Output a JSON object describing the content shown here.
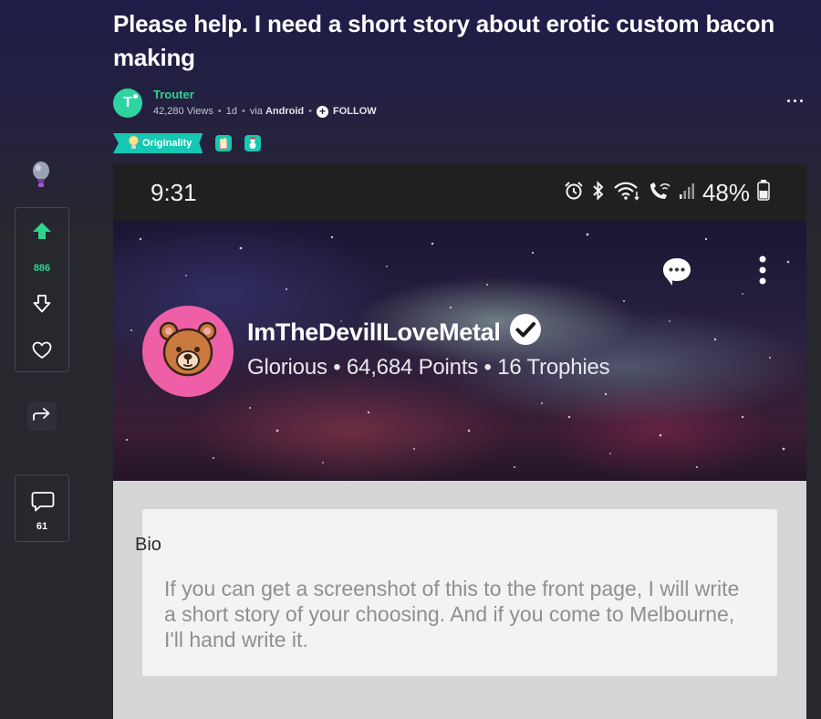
{
  "post": {
    "title": "Please help. I need a short story about erotic custom bacon making",
    "author": "Trouter",
    "avatar_letter": "T",
    "views": "42,280 Views",
    "age": "1d",
    "via_prefix": "via",
    "via_platform": "Android",
    "follow_label": "FOLLOW",
    "separator": "•",
    "badge_label": "Originality"
  },
  "rail": {
    "vote_count": "886",
    "comment_count": "61"
  },
  "screenshot": {
    "status": {
      "time": "9:31",
      "battery": "48%"
    },
    "profile": {
      "username": "ImTheDevilILoveMetal",
      "stats": "Glorious • 64,684 Points • 16 Trophies"
    },
    "bio": {
      "title": "Bio",
      "text": "If you can get a screenshot of this to the front page, I will write a short story of your choosing. And if you come to Melbourne, I'll hand write it."
    }
  },
  "colors": {
    "accent_green": "#2fd58f",
    "badge_teal": "#16c7b3",
    "avatar_pink": "#ee5fa8",
    "header_bg": "#1f1d49",
    "page_bg": "#27272e"
  },
  "icons": [
    "upvote-icon",
    "downvote-icon",
    "heart-icon",
    "share-icon",
    "comment-icon",
    "balloon-icon",
    "more-icon",
    "follow-plus-icon",
    "lightbulb-icon",
    "chat-bubble-icon",
    "kebab-icon",
    "verified-icon",
    "bear-avatar-icon",
    "alarm-icon",
    "bluetooth-icon",
    "wifi-icon",
    "call-icon",
    "signal-icon",
    "battery-icon"
  ]
}
